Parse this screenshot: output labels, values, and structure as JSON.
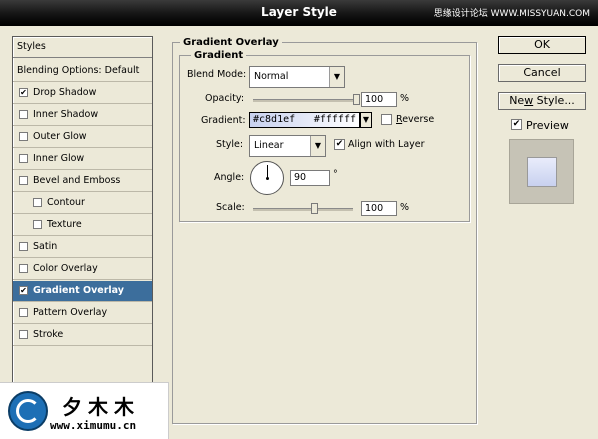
{
  "window": {
    "title": "Layer Style",
    "watermark_top": "思缘设计论坛 WWW.MISSYUAN.COM"
  },
  "sidebar": {
    "header": "Styles",
    "items": [
      {
        "label": "Blending Options: Default",
        "checkbox": false,
        "checked": false,
        "selected": false
      },
      {
        "label": "Drop Shadow",
        "checkbox": true,
        "checked": true,
        "selected": false
      },
      {
        "label": "Inner Shadow",
        "checkbox": true,
        "checked": false,
        "selected": false
      },
      {
        "label": "Outer Glow",
        "checkbox": true,
        "checked": false,
        "selected": false
      },
      {
        "label": "Inner Glow",
        "checkbox": true,
        "checked": false,
        "selected": false
      },
      {
        "label": "Bevel and Emboss",
        "checkbox": true,
        "checked": false,
        "selected": false
      },
      {
        "label": "Contour",
        "checkbox": true,
        "checked": false,
        "selected": false,
        "indent": true
      },
      {
        "label": "Texture",
        "checkbox": true,
        "checked": false,
        "selected": false,
        "indent": true
      },
      {
        "label": "Satin",
        "checkbox": true,
        "checked": false,
        "selected": false
      },
      {
        "label": "Color Overlay",
        "checkbox": true,
        "checked": false,
        "selected": false
      },
      {
        "label": "Gradient Overlay",
        "checkbox": true,
        "checked": true,
        "selected": true
      },
      {
        "label": "Pattern Overlay",
        "checkbox": true,
        "checked": false,
        "selected": false
      },
      {
        "label": "Stroke",
        "checkbox": true,
        "checked": false,
        "selected": false
      }
    ]
  },
  "panel": {
    "section_title": "Gradient Overlay",
    "subsection_title": "Gradient",
    "blend_mode": {
      "label": "Blend Mode:",
      "value": "Normal"
    },
    "opacity": {
      "label": "Opacity:",
      "value": "100",
      "unit": "%",
      "fraction": 1.0
    },
    "gradient": {
      "label": "Gradient:",
      "start": "#c8d1ef",
      "end": "#ffffff",
      "reverse_label": "Reverse",
      "reverse_checked": false
    },
    "style": {
      "label": "Style:",
      "value": "Linear",
      "align_label": "Align with Layer",
      "align_checked": true
    },
    "angle": {
      "label": "Angle:",
      "value": "90",
      "unit": "°"
    },
    "scale": {
      "label": "Scale:",
      "value": "100",
      "unit": "%",
      "fraction": 0.5
    }
  },
  "buttons": {
    "ok": "OK",
    "cancel": "Cancel",
    "new_style": "New Style...",
    "preview": "Preview",
    "preview_checked": true
  },
  "logo": {
    "text": "夕木木",
    "url": "www.ximumu.cn"
  },
  "colors": {
    "selected_row": "#3c6e9c",
    "gradient_start": "#c8d1ef",
    "gradient_end": "#ffffff"
  }
}
